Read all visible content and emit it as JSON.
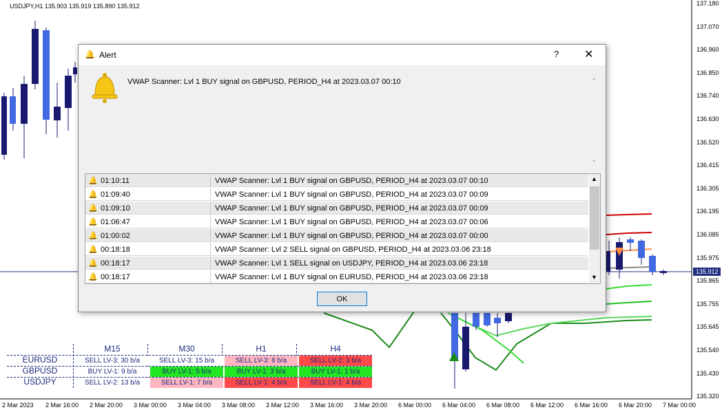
{
  "chart": {
    "symbol_info": "USDJPY,H1  135.903 135.919 135.890 135.912",
    "current_price": "135.912",
    "price_labels": [
      "137.180",
      "137.070",
      "136.960",
      "136.850",
      "136.740",
      "136.630",
      "136.520",
      "136.415",
      "136.305",
      "136.195",
      "136.085",
      "135.975",
      "135.865",
      "135.755",
      "135.645",
      "135.540",
      "135.430",
      "135.320"
    ],
    "time_labels": [
      "2 Mar 2023",
      "2 Mar 16:00",
      "2 Mar 20:00",
      "3 Mar 00:00",
      "3 Mar 04:00",
      "3 Mar 08:00",
      "3 Mar 12:00",
      "3 Mar 16:00",
      "3 Mar 20:00",
      "6 Mar 00:00",
      "6 Mar 04:00",
      "6 Mar 08:00",
      "6 Mar 12:00",
      "6 Mar 16:00",
      "6 Mar 20:00",
      "7 Mar 00:00"
    ],
    "colors": {
      "bull": "#4169e1",
      "bear": "#191970",
      "red_band": "#cc0000",
      "green_band": "#1a8a1a",
      "light_green": "#33dd33",
      "orange": "#ff8c42"
    }
  },
  "scanner": {
    "columns": [
      "M15",
      "M30",
      "H1",
      "H4"
    ],
    "rows": [
      {
        "symbol": "EURUSD",
        "cells": [
          {
            "text": "SELL LV-3: 30 b/a",
            "style": "white"
          },
          {
            "text": "SELL LV-3: 15 b/a",
            "style": "white"
          },
          {
            "text": "SELL LV-3: 8 b/a",
            "style": "pink"
          },
          {
            "text": "SELL LV-2: 3 b/a",
            "style": "red"
          }
        ]
      },
      {
        "symbol": "GBPUSD",
        "cells": [
          {
            "text": "BUY LV-1: 9 b/a",
            "style": "white"
          },
          {
            "text": "BUY LV-1: 5 b/a",
            "style": "green"
          },
          {
            "text": "BUY LV-1: 3 b/a",
            "style": "green"
          },
          {
            "text": "BUY LV-1: 1 b/a",
            "style": "green"
          }
        ]
      },
      {
        "symbol": "USDJPY",
        "cells": [
          {
            "text": "SELL LV-2: 13 b/a",
            "style": "white"
          },
          {
            "text": "SELL LV-1: 7 b/a",
            "style": "pink"
          },
          {
            "text": "SELL LV-1: 4 b/a",
            "style": "red"
          },
          {
            "text": "SELL LV-1: 4 b/a",
            "style": "red"
          }
        ]
      }
    ]
  },
  "dialog": {
    "title": "Alert",
    "help_label": "?",
    "close_label": "✕",
    "message": "VWAP Scanner: Lvl 1 BUY signal on GBPUSD, PERIOD_H4 at 2023.03.07 00:10",
    "ok_label": "OK",
    "alerts": [
      {
        "time": "01:10:11",
        "message": "VWAP Scanner: Lvl 1 BUY signal on GBPUSD, PERIOD_H4 at 2023.03.07 00:10"
      },
      {
        "time": "01:09:40",
        "message": "VWAP Scanner: Lvl 1 BUY signal on GBPUSD, PERIOD_H4 at 2023.03.07 00:09"
      },
      {
        "time": "01:09:10",
        "message": "VWAP Scanner: Lvl 1 BUY signal on GBPUSD, PERIOD_H4 at 2023.03.07 00:09"
      },
      {
        "time": "01:06:47",
        "message": "VWAP Scanner: Lvl 1 BUY signal on GBPUSD, PERIOD_H4 at 2023.03.07 00:06"
      },
      {
        "time": "01:00:02",
        "message": "VWAP Scanner: Lvl 1 BUY signal on GBPUSD, PERIOD_H4 at 2023.03.07 00:00"
      },
      {
        "time": "00:18:18",
        "message": "VWAP Scanner: Lvl 2 SELL signal on GBPUSD, PERIOD_H4 at 2023.03.06 23:18"
      },
      {
        "time": "00:18:17",
        "message": "VWAP Scanner: Lvl 1 SELL signal on USDJPY, PERIOD_H4 at 2023.03.06 23:18"
      },
      {
        "time": "00:18:17",
        "message": "VWAP Scanner: Lvl 1 BUY signal on EURUSD, PERIOD_H4 at 2023.03.06 23:18"
      }
    ]
  }
}
